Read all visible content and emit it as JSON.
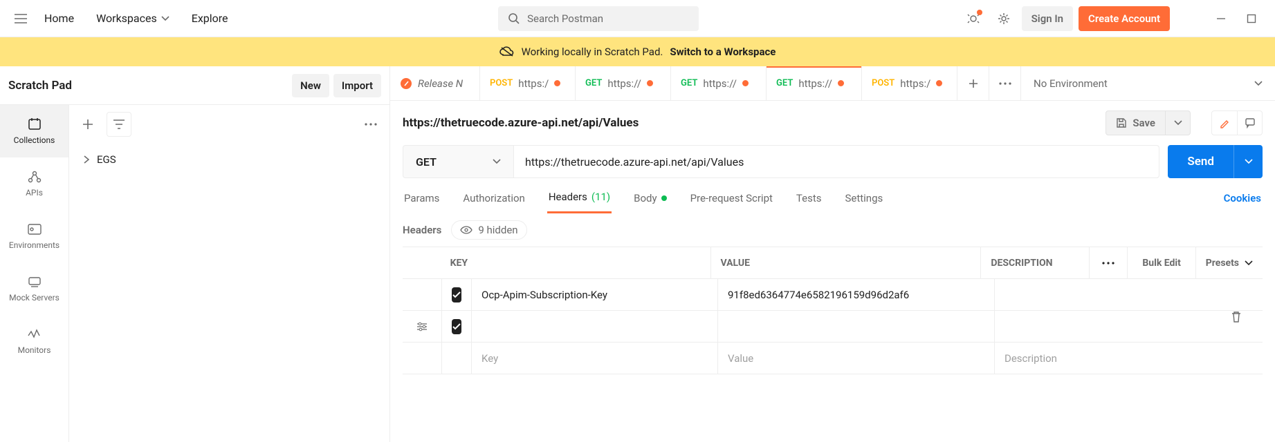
{
  "header": {
    "nav": {
      "home": "Home",
      "workspaces": "Workspaces",
      "explore": "Explore"
    },
    "search_placeholder": "Search Postman",
    "signin": "Sign In",
    "create": "Create Account"
  },
  "banner": {
    "text": "Working locally in Scratch Pad.",
    "link": "Switch to a Workspace"
  },
  "sidebar": {
    "title": "Scratch Pad",
    "new_btn": "New",
    "import_btn": "Import",
    "rail": [
      {
        "label": "Collections"
      },
      {
        "label": "APIs"
      },
      {
        "label": "Environments"
      },
      {
        "label": "Mock Servers"
      },
      {
        "label": "Monitors"
      }
    ],
    "tree": [
      {
        "label": "EGS"
      }
    ]
  },
  "tabs": [
    {
      "kind": "release",
      "label": "Release N"
    },
    {
      "kind": "req",
      "method": "POST",
      "label": "https:/",
      "dirty": true
    },
    {
      "kind": "req",
      "method": "GET",
      "label": "https://",
      "dirty": true
    },
    {
      "kind": "req",
      "method": "GET",
      "label": "https://",
      "dirty": true
    },
    {
      "kind": "req",
      "method": "GET",
      "label": "https://",
      "dirty": true,
      "active": true
    },
    {
      "kind": "req",
      "method": "POST",
      "label": "https:/",
      "dirty": true
    }
  ],
  "env_selector": "No Environment",
  "request": {
    "title": "https://thetruecode.azure-api.net/api/Values",
    "save": "Save",
    "method": "GET",
    "url": "https://thetruecode.azure-api.net/api/Values",
    "send": "Send"
  },
  "subtabs": {
    "params": "Params",
    "auth": "Authorization",
    "headers": "Headers",
    "headers_count": "(11)",
    "body": "Body",
    "prereq": "Pre-request Script",
    "tests": "Tests",
    "settings": "Settings",
    "cookies": "Cookies"
  },
  "headers_section": {
    "title": "Headers",
    "hidden": "9 hidden",
    "cols": {
      "key": "KEY",
      "value": "VALUE",
      "desc": "DESCRIPTION",
      "bulk": "Bulk Edit",
      "presets": "Presets"
    },
    "rows": [
      {
        "key": "Ocp-Apim-Subscription-Key",
        "value": "91f8ed6364774e6582196159d96d2af6"
      }
    ],
    "placeholders": {
      "key": "Key",
      "value": "Value",
      "desc": "Description"
    }
  }
}
